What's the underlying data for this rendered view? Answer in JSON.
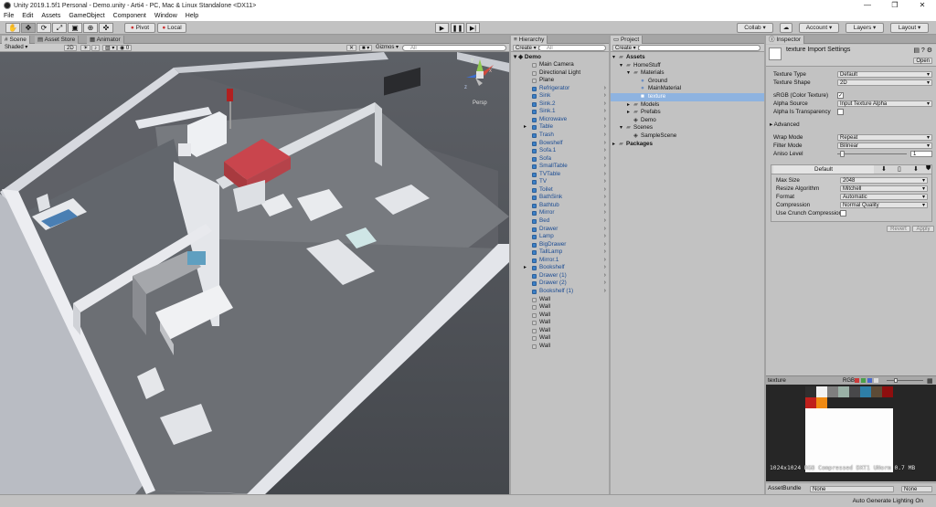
{
  "window": {
    "title": "Unity 2019.1.5f1 Personal - Demo.unity - Arti4 - PC, Mac & Linux Standalone <DX11>",
    "controls": [
      "—",
      "❐",
      "✕"
    ]
  },
  "menu": [
    "File",
    "Edit",
    "Assets",
    "GameObject",
    "Component",
    "Window",
    "Help"
  ],
  "toolbar": {
    "pivot": "Pivot",
    "local": "Local",
    "collab": "Collab ▾",
    "account": "Account ▾",
    "layers": "Layers ▾",
    "layout": "Layout ▾"
  },
  "scene": {
    "tabs": [
      "Scene",
      "Asset Store",
      "Animator"
    ],
    "shading": "Shaded",
    "mode_2d": "2D",
    "gizmos": "Gizmos ▾",
    "search_placeholder": "All",
    "persp": "Persp",
    "axes": [
      "y",
      "x",
      "z"
    ]
  },
  "hierarchy": {
    "tab": "Hierarchy",
    "create": "Create ▾",
    "search_placeholder": "All",
    "root": "Demo",
    "items": [
      {
        "label": "Main Camera",
        "prefab": false,
        "arrow": false,
        "expand": false
      },
      {
        "label": "Directional Light",
        "prefab": false,
        "arrow": false,
        "expand": false
      },
      {
        "label": "Plane",
        "prefab": false,
        "arrow": false,
        "expand": false
      },
      {
        "label": "Refrigerator",
        "prefab": true,
        "arrow": true,
        "expand": false
      },
      {
        "label": "Sink",
        "prefab": true,
        "arrow": true,
        "expand": false
      },
      {
        "label": "Sink.2",
        "prefab": true,
        "arrow": true,
        "expand": false
      },
      {
        "label": "Sink.1",
        "prefab": true,
        "arrow": true,
        "expand": false
      },
      {
        "label": "Microwave",
        "prefab": true,
        "arrow": true,
        "expand": false
      },
      {
        "label": "Table",
        "prefab": true,
        "arrow": true,
        "expand": true
      },
      {
        "label": "Trash",
        "prefab": true,
        "arrow": true,
        "expand": false
      },
      {
        "label": "Bowshelf",
        "prefab": true,
        "arrow": true,
        "expand": false
      },
      {
        "label": "Sofa.1",
        "prefab": true,
        "arrow": true,
        "expand": false
      },
      {
        "label": "Sofa",
        "prefab": true,
        "arrow": true,
        "expand": false
      },
      {
        "label": "SmallTable",
        "prefab": true,
        "arrow": true,
        "expand": false
      },
      {
        "label": "TVTable",
        "prefab": true,
        "arrow": true,
        "expand": false
      },
      {
        "label": "TV",
        "prefab": true,
        "arrow": true,
        "expand": false
      },
      {
        "label": "Toilet",
        "prefab": true,
        "arrow": true,
        "expand": false
      },
      {
        "label": "BathSink",
        "prefab": true,
        "arrow": true,
        "expand": false
      },
      {
        "label": "Bathtub",
        "prefab": true,
        "arrow": true,
        "expand": false
      },
      {
        "label": "Mirror",
        "prefab": true,
        "arrow": true,
        "expand": false
      },
      {
        "label": "Bed",
        "prefab": true,
        "arrow": true,
        "expand": false
      },
      {
        "label": "Drawer",
        "prefab": true,
        "arrow": true,
        "expand": false
      },
      {
        "label": "Lamp",
        "prefab": true,
        "arrow": true,
        "expand": false
      },
      {
        "label": "BigDrawer",
        "prefab": true,
        "arrow": true,
        "expand": false
      },
      {
        "label": "TallLamp",
        "prefab": true,
        "arrow": true,
        "expand": false
      },
      {
        "label": "Mirror.1",
        "prefab": true,
        "arrow": true,
        "expand": false
      },
      {
        "label": "Bookshelf",
        "prefab": true,
        "arrow": true,
        "expand": true
      },
      {
        "label": "Drawer (1)",
        "prefab": true,
        "arrow": true,
        "expand": false
      },
      {
        "label": "Drawer (2)",
        "prefab": true,
        "arrow": true,
        "expand": false
      },
      {
        "label": "Bookshelf (1)",
        "prefab": true,
        "arrow": true,
        "expand": false
      },
      {
        "label": "Wall",
        "prefab": false,
        "arrow": false,
        "expand": false
      },
      {
        "label": "Wall",
        "prefab": false,
        "arrow": false,
        "expand": false
      },
      {
        "label": "Wall",
        "prefab": false,
        "arrow": false,
        "expand": false
      },
      {
        "label": "Wall",
        "prefab": false,
        "arrow": false,
        "expand": false
      },
      {
        "label": "Wall",
        "prefab": false,
        "arrow": false,
        "expand": false
      },
      {
        "label": "Wall",
        "prefab": false,
        "arrow": false,
        "expand": false
      },
      {
        "label": "Wall",
        "prefab": false,
        "arrow": false,
        "expand": false
      }
    ]
  },
  "project": {
    "tab": "Project",
    "create": "Create ▾",
    "items": [
      {
        "label": "Assets",
        "depth": 0,
        "bold": true,
        "icon": "folder",
        "tri": "▾"
      },
      {
        "label": "HomeStuff",
        "depth": 1,
        "bold": false,
        "icon": "folder",
        "tri": "▾"
      },
      {
        "label": "Materials",
        "depth": 2,
        "bold": false,
        "icon": "folder",
        "tri": "▾"
      },
      {
        "label": "Ground",
        "depth": 3,
        "bold": false,
        "icon": "sphere",
        "tri": ""
      },
      {
        "label": "MainMaterial",
        "depth": 3,
        "bold": false,
        "icon": "sphere",
        "tri": ""
      },
      {
        "label": "texture",
        "depth": 3,
        "bold": false,
        "icon": "texture",
        "tri": "",
        "selected": true
      },
      {
        "label": "Models",
        "depth": 2,
        "bold": false,
        "icon": "folder",
        "tri": "▸"
      },
      {
        "label": "Prefabs",
        "depth": 2,
        "bold": false,
        "icon": "folder",
        "tri": "▸"
      },
      {
        "label": "Demo",
        "depth": 2,
        "bold": false,
        "icon": "unity",
        "tri": ""
      },
      {
        "label": "Scenes",
        "depth": 1,
        "bold": false,
        "icon": "folder",
        "tri": "▾"
      },
      {
        "label": "SampleScene",
        "depth": 2,
        "bold": false,
        "icon": "unity",
        "tri": ""
      },
      {
        "label": "Packages",
        "depth": 0,
        "bold": true,
        "icon": "folder",
        "tri": "▸"
      }
    ]
  },
  "inspector": {
    "tab": "Inspector",
    "title": "texture Import Settings",
    "open": "Open",
    "texture_type": {
      "label": "Texture Type",
      "value": "Default"
    },
    "texture_shape": {
      "label": "Texture Shape",
      "value": "2D"
    },
    "srgb": {
      "label": "sRGB (Color Texture)",
      "checked": "✓"
    },
    "alpha_source": {
      "label": "Alpha Source",
      "value": "Input Texture Alpha"
    },
    "alpha_transparency": {
      "label": "Alpha Is Transparency",
      "checked": ""
    },
    "advanced": "Advanced",
    "wrap_mode": {
      "label": "Wrap Mode",
      "value": "Repeat"
    },
    "filter_mode": {
      "label": "Filter Mode",
      "value": "Bilinear"
    },
    "aniso_level": {
      "label": "Aniso Level",
      "value": "1"
    },
    "platform_default": "Default",
    "max_size": {
      "label": "Max Size",
      "value": "2048"
    },
    "resize": {
      "label": "Resize Algorithm",
      "value": "Mitchell"
    },
    "format": {
      "label": "Format",
      "value": "Automatic"
    },
    "compression": {
      "label": "Compression",
      "value": "Normal Quality"
    },
    "crunch": {
      "label": "Use Crunch Compression",
      "checked": ""
    },
    "revert": "Revert",
    "apply": "Apply",
    "preview": {
      "title": "texture",
      "rgb": "RGB",
      "info": "1024x1024  RGB Compressed DXT1 UNorm  0.7 MB",
      "palette": [
        "#2f2f2f",
        "#f2f2f2",
        "#7f7f7f",
        "#9ab1a6",
        "#48484a",
        "#2e7fa7",
        "#5d4b36",
        "#8e0e0e",
        "#c0201c",
        "#f08a12"
      ]
    },
    "assetbundle": {
      "label": "AssetBundle",
      "value": "None",
      "variant": "None"
    }
  },
  "status": {
    "text": "Auto Generate Lighting On"
  }
}
